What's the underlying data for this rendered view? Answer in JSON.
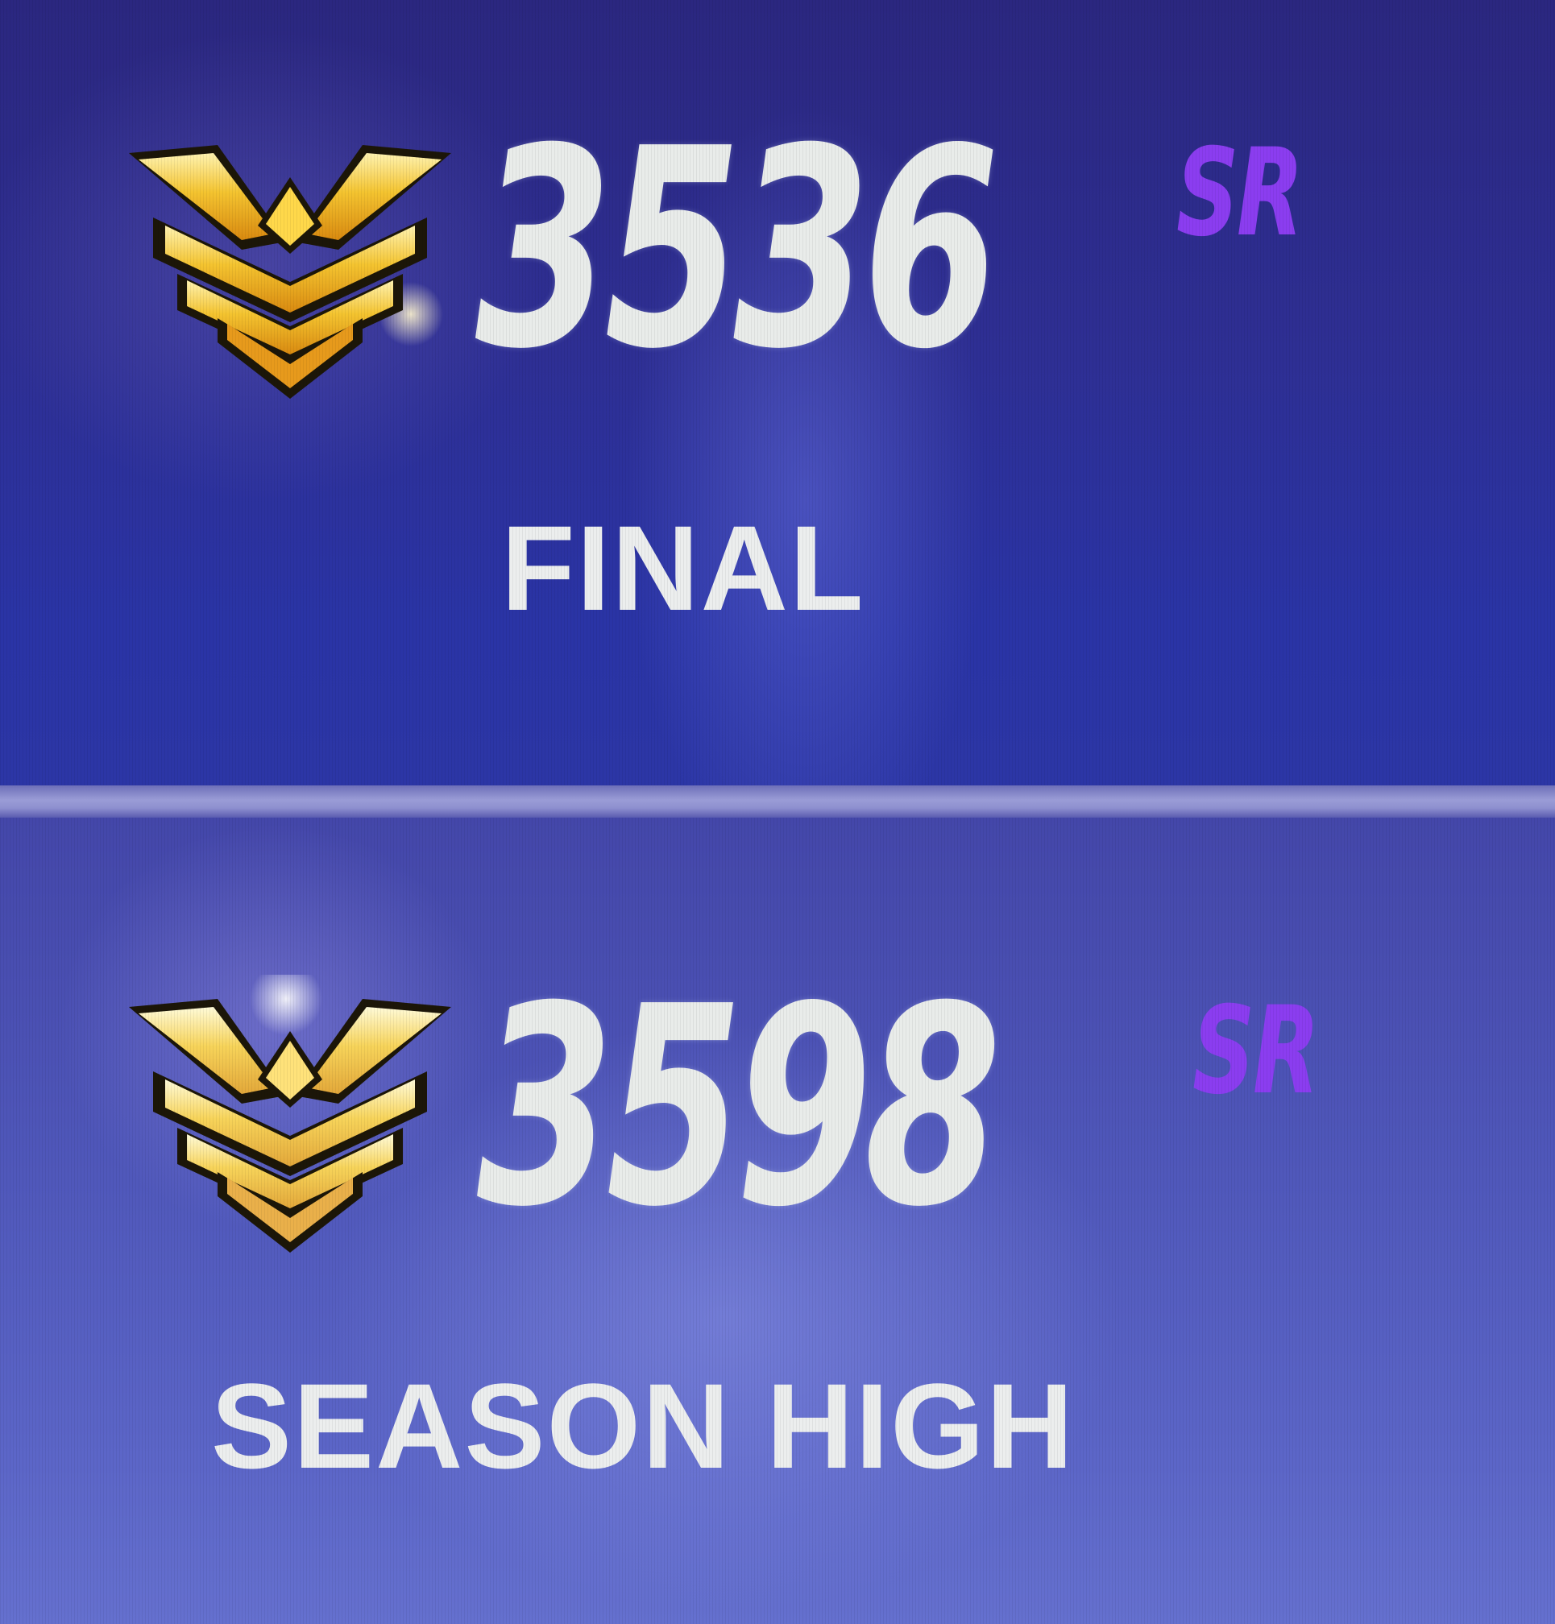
{
  "colors": {
    "value_text": "#e9ecea",
    "unit_text": "#8b3df0",
    "label_text": "#eceeee",
    "rank_gold": "#f2b318"
  },
  "final": {
    "rank_icon": "master-rank-icon",
    "value": "3536",
    "unit": "SR",
    "label": "FINAL"
  },
  "season_high": {
    "rank_icon": "master-rank-icon",
    "value": "3598",
    "unit": "SR",
    "label": "SEASON HIGH"
  }
}
